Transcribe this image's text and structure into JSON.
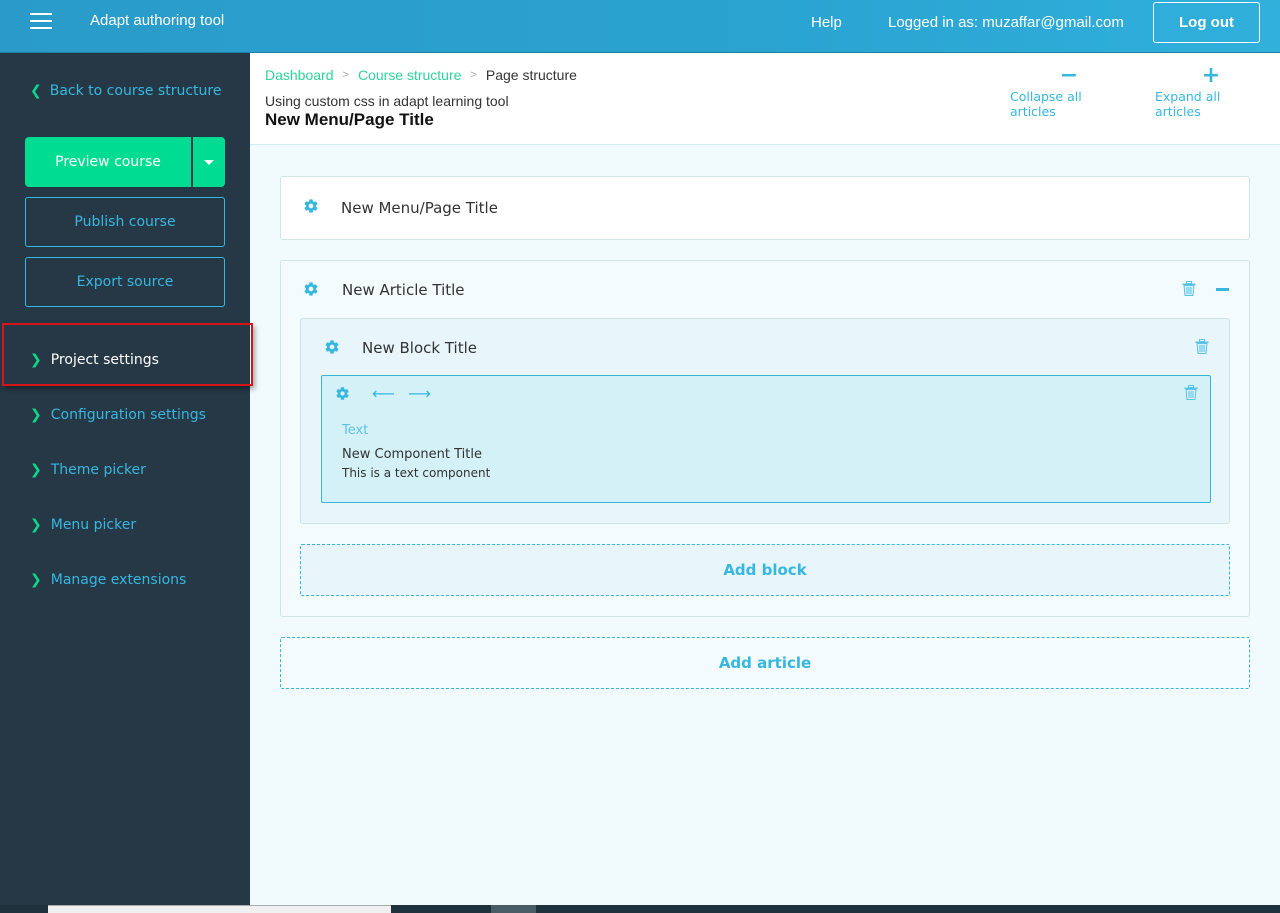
{
  "topbar": {
    "menu_icon": "hamburger-icon",
    "app_title": "Adapt authoring tool",
    "help_label": "Help",
    "logged_in_text": "Logged in as: muzaffar@gmail.com",
    "logout_label": "Log out"
  },
  "sidebar": {
    "back_label": "Back to course structure",
    "preview_label": "Preview course",
    "publish_label": "Publish course",
    "export_label": "Export source",
    "nav_items": [
      {
        "label": "Project settings",
        "active": true
      },
      {
        "label": "Configuration settings"
      },
      {
        "label": "Theme picker"
      },
      {
        "label": "Menu picker"
      },
      {
        "label": "Manage extensions"
      }
    ]
  },
  "header": {
    "breadcrumb": [
      {
        "label": "Dashboard",
        "link": true
      },
      {
        "label": "Course structure",
        "link": true
      },
      {
        "label": "Page structure",
        "link": false
      }
    ],
    "breadcrumb_separator": ">",
    "course_title": "Using custom css in adapt learning tool",
    "page_title": "New Menu/Page Title",
    "collapse_label": "Collapse all articles",
    "collapse_symbol": "−",
    "expand_label": "Expand all articles",
    "expand_symbol": "+"
  },
  "content": {
    "page_card_title": "New Menu/Page Title",
    "article": {
      "title": "New Article Title",
      "block": {
        "title": "New Block Title",
        "component": {
          "type": "Text",
          "title": "New Component Title",
          "body": "This is a text component",
          "arrow_left": "⟵",
          "arrow_right": "⟶"
        }
      },
      "add_block_label": "Add block"
    },
    "add_article_label": "Add article"
  },
  "colors": {
    "topbar": "#2aa3d1",
    "sidebar": "#263845",
    "accent": "#36b7e0",
    "green": "#00dc91",
    "highlight": "#d5141c"
  }
}
